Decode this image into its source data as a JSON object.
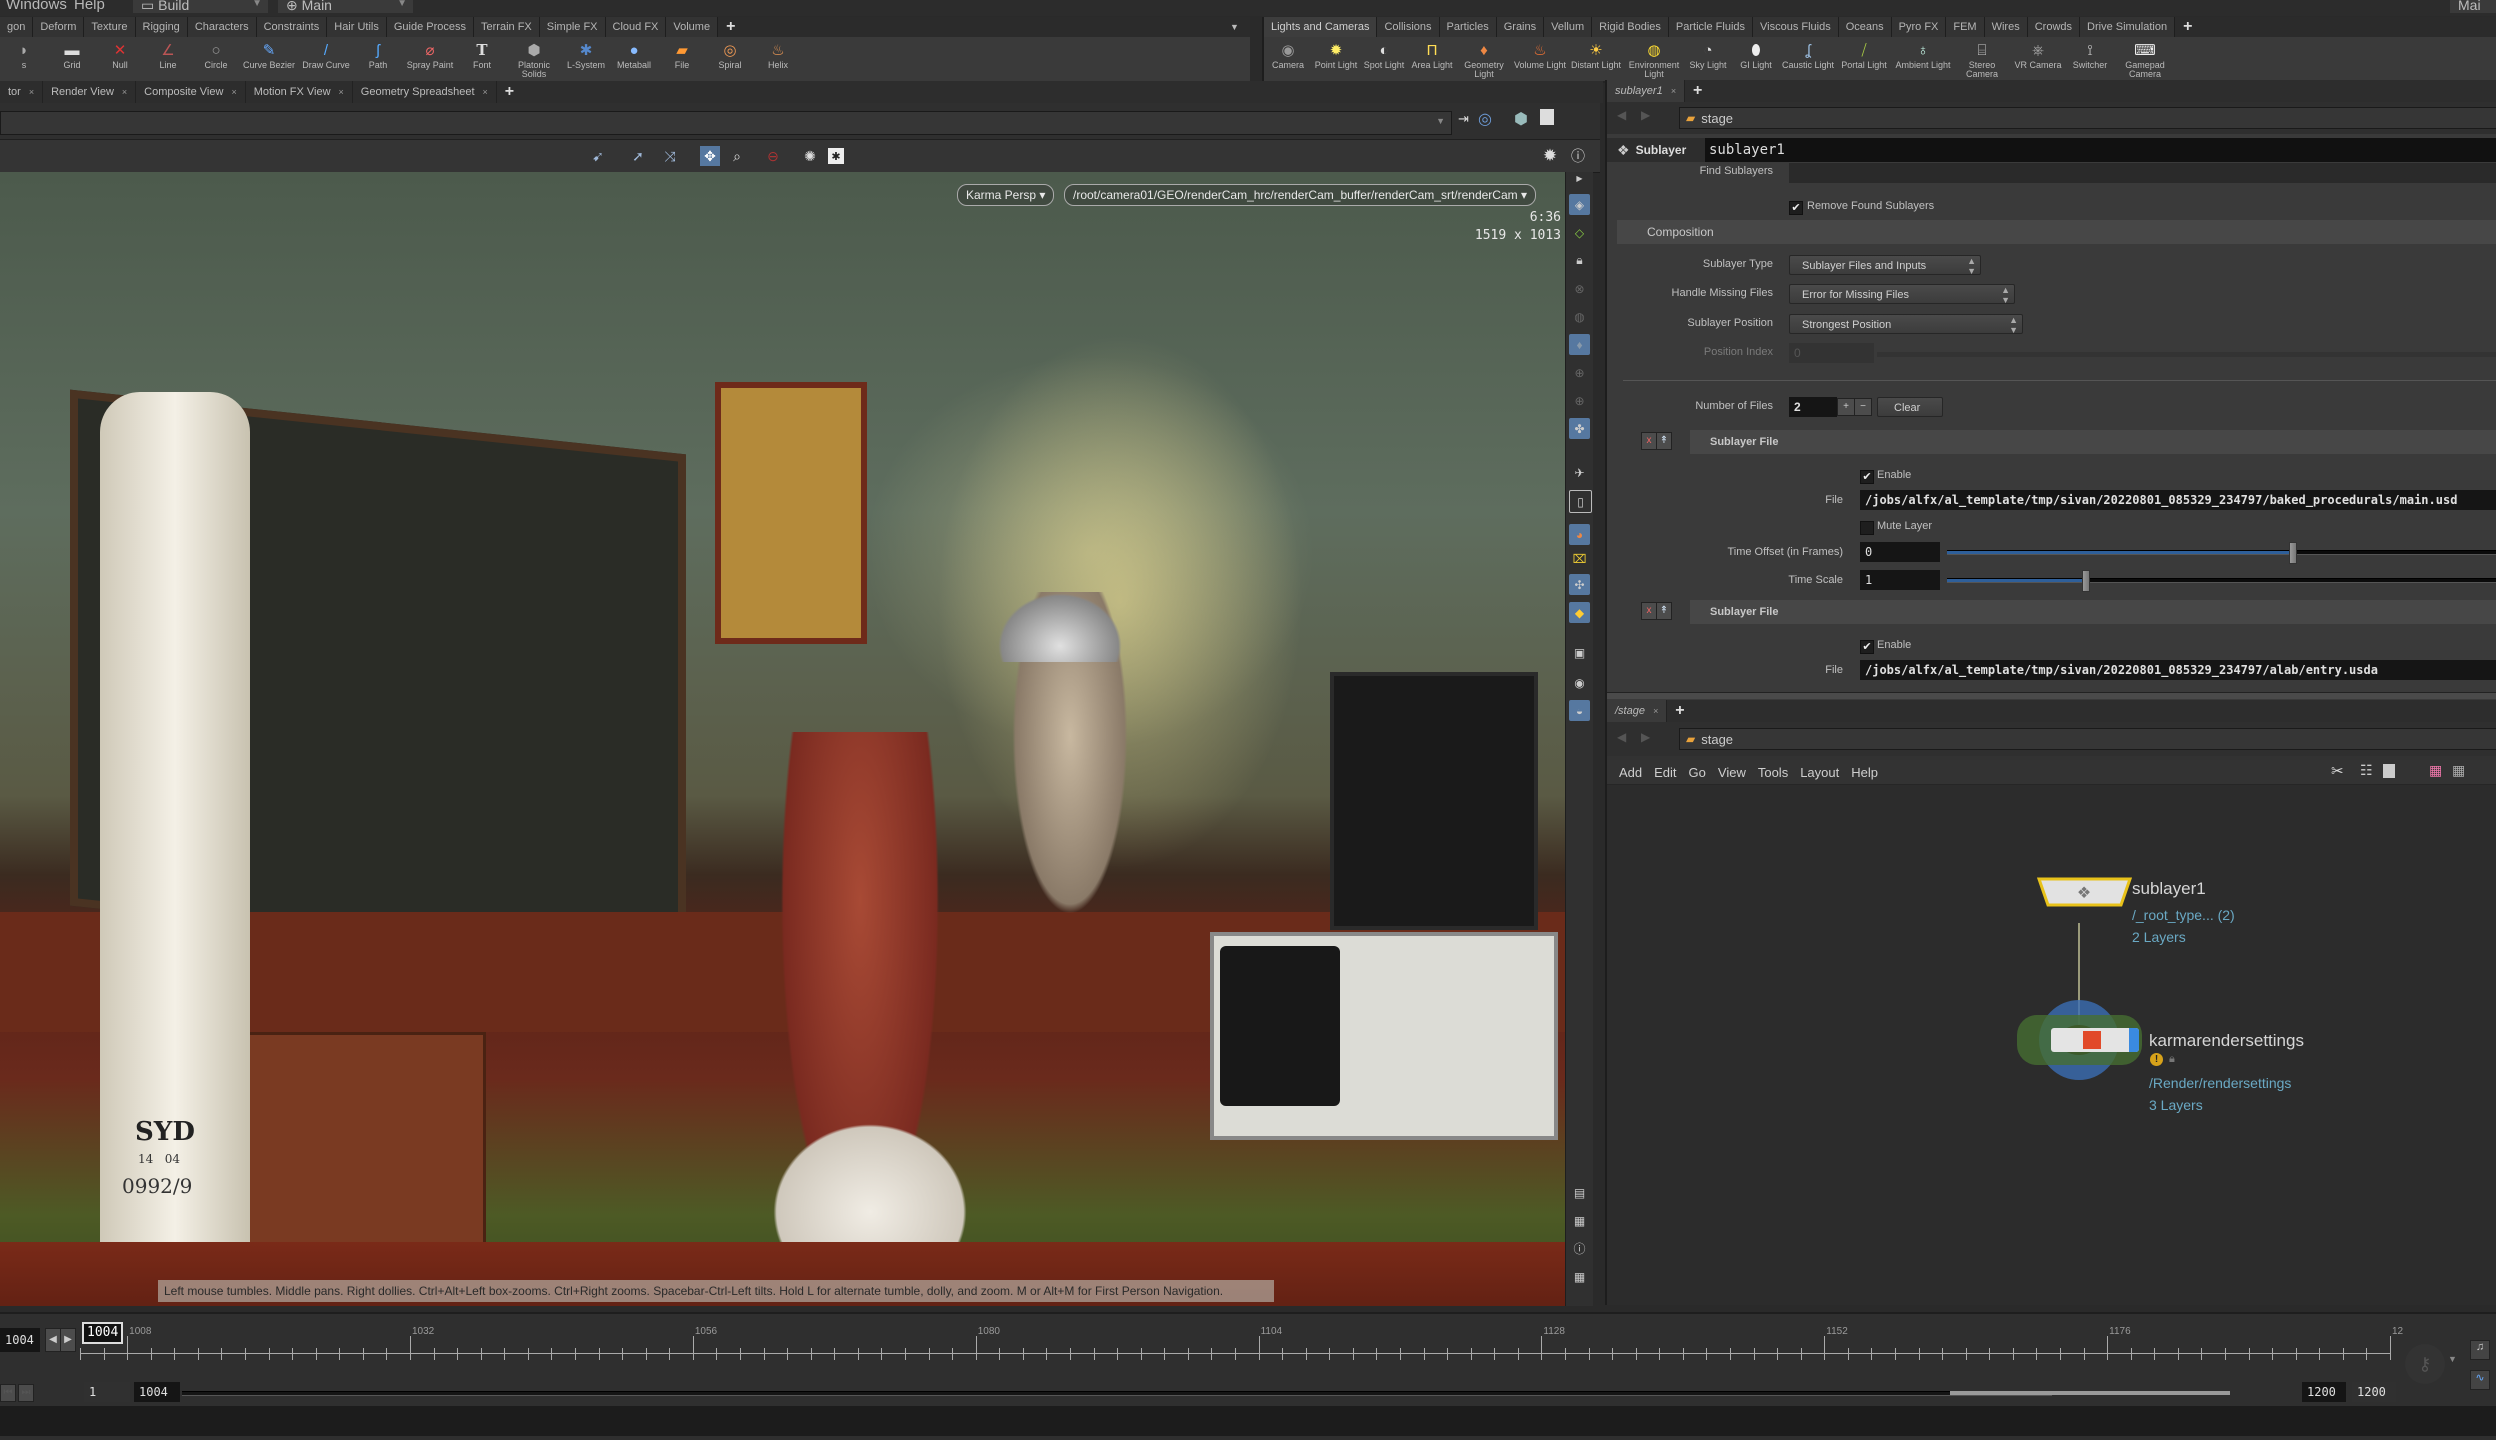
{
  "menubar": {
    "items": [
      "Windows",
      "Help"
    ],
    "desktop": "Build",
    "context": "Main",
    "right_context": "Mai"
  },
  "left_shelf": {
    "tabs": [
      "gon",
      "Deform",
      "Texture",
      "Rigging",
      "Characters",
      "Constraints",
      "Hair Utils",
      "Guide Process",
      "Terrain FX",
      "Simple FX",
      "Cloud FX",
      "Volume"
    ],
    "tools": [
      {
        "label": "s",
        "icon": "sphere-icon"
      },
      {
        "label": "Grid",
        "icon": "grid-icon"
      },
      {
        "label": "Null",
        "icon": "null-icon"
      },
      {
        "label": "Line",
        "icon": "line-icon"
      },
      {
        "label": "Circle",
        "icon": "circle-icon"
      },
      {
        "label": "Curve Bezier",
        "icon": "curve-bezier-icon"
      },
      {
        "label": "Draw Curve",
        "icon": "draw-curve-icon"
      },
      {
        "label": "Path",
        "icon": "path-icon"
      },
      {
        "label": "Spray Paint",
        "icon": "spray-paint-icon"
      },
      {
        "label": "Font",
        "icon": "font-icon"
      },
      {
        "label": "Platonic Solids",
        "icon": "platonic-solids-icon"
      },
      {
        "label": "L-System",
        "icon": "l-system-icon"
      },
      {
        "label": "Metaball",
        "icon": "metaball-icon"
      },
      {
        "label": "File",
        "icon": "file-icon"
      },
      {
        "label": "Spiral",
        "icon": "spiral-icon"
      },
      {
        "label": "Helix",
        "icon": "helix-icon"
      }
    ]
  },
  "right_shelf": {
    "tabs": [
      "Lights and Cameras",
      "Collisions",
      "Particles",
      "Grains",
      "Vellum",
      "Rigid Bodies",
      "Particle Fluids",
      "Viscous Fluids",
      "Oceans",
      "Pyro FX",
      "FEM",
      "Wires",
      "Crowds",
      "Drive Simulation"
    ],
    "tools": [
      {
        "label": "Camera",
        "icon": "camera-icon"
      },
      {
        "label": "Point Light",
        "icon": "point-light-icon"
      },
      {
        "label": "Spot Light",
        "icon": "spot-light-icon"
      },
      {
        "label": "Area Light",
        "icon": "area-light-icon"
      },
      {
        "label": "Geometry Light",
        "icon": "geometry-light-icon"
      },
      {
        "label": "Volume Light",
        "icon": "volume-light-icon"
      },
      {
        "label": "Distant Light",
        "icon": "distant-light-icon"
      },
      {
        "label": "Environment Light",
        "icon": "environment-light-icon"
      },
      {
        "label": "Sky Light",
        "icon": "sky-light-icon"
      },
      {
        "label": "GI Light",
        "icon": "gi-light-icon"
      },
      {
        "label": "Caustic Light",
        "icon": "caustic-light-icon"
      },
      {
        "label": "Portal Light",
        "icon": "portal-light-icon"
      },
      {
        "label": "Ambient Light",
        "icon": "ambient-light-icon"
      },
      {
        "label": "Stereo Camera",
        "icon": "stereo-camera-icon"
      },
      {
        "label": "VR Camera",
        "icon": "vr-camera-icon"
      },
      {
        "label": "Switcher",
        "icon": "switcher-icon"
      },
      {
        "label": "Gamepad Camera",
        "icon": "gamepad-camera-icon"
      }
    ]
  },
  "viewer_tabs": [
    "tor",
    "Render View",
    "Composite View",
    "Motion FX View",
    "Geometry Spreadsheet"
  ],
  "viewport": {
    "camera_menu": "Karma Persp",
    "camera_path": "/root/camera01/GEO/renderCam_hrc/renderCam_buffer/renderCam_srt/renderCam",
    "render_time": "6:36",
    "resolution": "1519 x 1013",
    "help_text": "Left mouse tumbles. Middle pans. Right dollies. Ctrl+Alt+Left box-zooms. Ctrl+Right zooms. Spacebar-Ctrl-Left tilts. Hold L for alternate tumble, dolly, and zoom.    M or Alt+M for First Person Navigation.",
    "scene_text": {
      "hand_label_1": "SYD",
      "hand_label_2": "14   04",
      "hand_label_3": "0992/9"
    }
  },
  "param_pane": {
    "tab": "sublayer1",
    "path": "stage",
    "node_type": "Sublayer",
    "node_name": "sublayer1",
    "find_sublayers_label": "Find Sublayers",
    "remove_found_label": "Remove Found Sublayers",
    "remove_found_checked": true,
    "composition_label": "Composition",
    "sublayer_type_label": "Sublayer Type",
    "sublayer_type_value": "Sublayer Files and Inputs",
    "handle_missing_label": "Handle Missing Files",
    "handle_missing_value": "Error for Missing Files",
    "sublayer_position_label": "Sublayer Position",
    "sublayer_position_value": "Strongest Position",
    "position_index_label": "Position Index",
    "position_index_value": "0",
    "num_files_label": "Number of Files",
    "num_files_value": "2",
    "clear_label": "Clear",
    "files": [
      {
        "header": "Sublayer File",
        "enable_label": "Enable",
        "enabled": true,
        "file_label": "File",
        "file_value": "/jobs/alfx/al_template/tmp/sivan/20220801_085329_234797/baked_procedurals/main.usd",
        "mute_label": "Mute Layer",
        "muted": false,
        "time_offset_label": "Time Offset (in Frames)",
        "time_offset_value": "0",
        "time_scale_label": "Time Scale",
        "time_scale_value": "1"
      },
      {
        "header": "Sublayer File",
        "enable_label": "Enable",
        "enabled": true,
        "file_label": "File",
        "file_value": "/jobs/alfx/al_template/tmp/sivan/20220801_085329_234797/alab/entry.usda"
      }
    ]
  },
  "network_pane": {
    "tab": "/stage",
    "path": "stage",
    "menu": [
      "Add",
      "Edit",
      "Go",
      "View",
      "Tools",
      "Layout",
      "Help"
    ],
    "nodes": [
      {
        "name": "sublayer1",
        "sub1": "/_root_type... (2)",
        "sub2": "2 Layers"
      },
      {
        "name": "karmarendersettings",
        "sub1": "/Render/rendersettings",
        "sub2": "3 Layers"
      }
    ]
  },
  "timeline": {
    "current_frame": "1004",
    "current_frame_field": "1004",
    "marker_label": "1004",
    "tick_labels": [
      "1008",
      "1032",
      "1056",
      "1080",
      "1104",
      "1128",
      "1152",
      "1176",
      "12"
    ],
    "range_start": "1",
    "range_start_frame": "1004",
    "range_end": "1200",
    "range_end_global": "1200"
  },
  "colors": {
    "accent_blue": "#2e5f9a",
    "node_selected": "#e8c21a",
    "node_info_text": "#6aa9c4",
    "display_flag": "#3a8ae0"
  }
}
